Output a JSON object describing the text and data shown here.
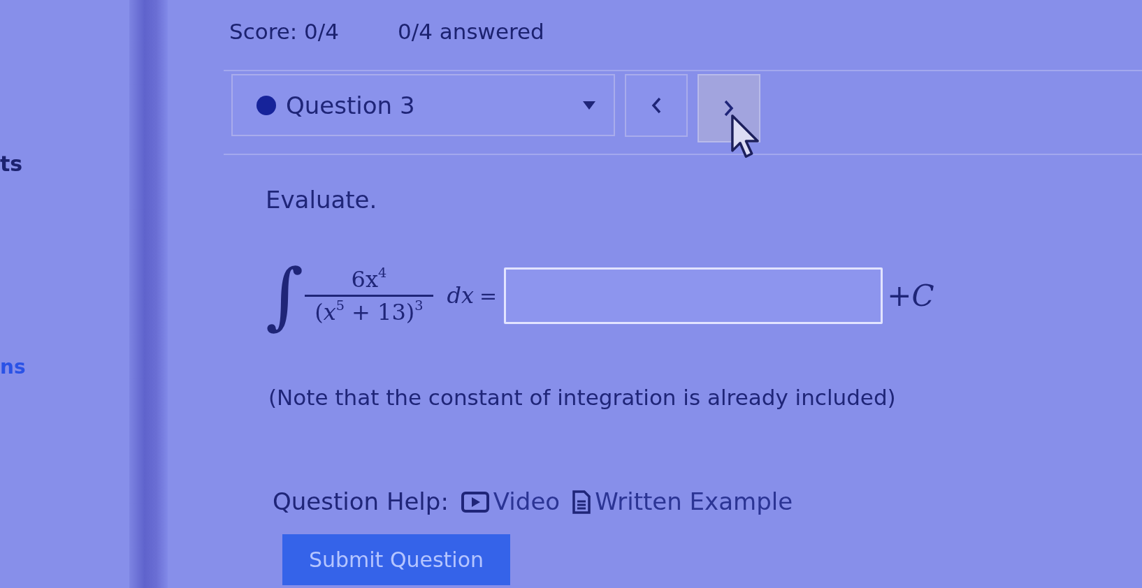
{
  "sidebar": {
    "items": [
      {
        "kind": "text",
        "label": "ts"
      },
      {
        "kind": "link",
        "label": "ns"
      }
    ]
  },
  "score_bar": {
    "score": "Score: 0/4",
    "answered": "0/4 answered"
  },
  "question_nav": {
    "select": {
      "label": "Question 3"
    },
    "nav_buttons": [
      {
        "kind": "previous",
        "hovered": false
      },
      {
        "kind": "next",
        "hovered": true
      }
    ]
  },
  "question": {
    "prompt": "Evaluate.",
    "integral": {
      "sign": "∫",
      "numerator": "6x$^{4}$",
      "denominator": "(*x*$^{5}$ + 13)$^{3}$",
      "differential": "dx",
      "equals": "="
    },
    "answer_suffix": "+*C*",
    "note": "(Note that the constant of integration is already included)"
  },
  "help": {
    "label": "Question Help:",
    "links": [
      {
        "kind": "video",
        "label": "Video"
      },
      {
        "kind": "written_example",
        "label": "Written Example"
      }
    ]
  },
  "submit": {
    "label": "Submit Question"
  }
}
